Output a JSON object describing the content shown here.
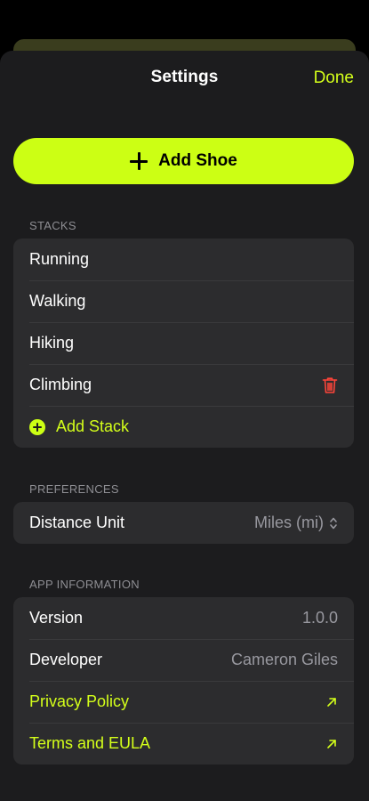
{
  "nav": {
    "title": "Settings",
    "done_label": "Done"
  },
  "add_shoe": {
    "label": "Add Shoe"
  },
  "stacks": {
    "header": "STACKS",
    "items": [
      {
        "label": "Running"
      },
      {
        "label": "Walking"
      },
      {
        "label": "Hiking"
      },
      {
        "label": "Climbing",
        "deletable": true
      }
    ],
    "add_label": "Add Stack"
  },
  "preferences": {
    "header": "PREFERENCES",
    "distance_unit": {
      "label": "Distance Unit",
      "value": "Miles (mi)"
    }
  },
  "app_info": {
    "header": "APP INFORMATION",
    "version": {
      "label": "Version",
      "value": "1.0.0"
    },
    "developer": {
      "label": "Developer",
      "value": "Cameron Giles"
    },
    "privacy_label": "Privacy Policy",
    "terms_label": "Terms and EULA"
  },
  "colors": {
    "accent": "#ccff14",
    "background": "#1c1c1e",
    "cell": "#2c2c2e",
    "destructive": "#ff453a"
  }
}
